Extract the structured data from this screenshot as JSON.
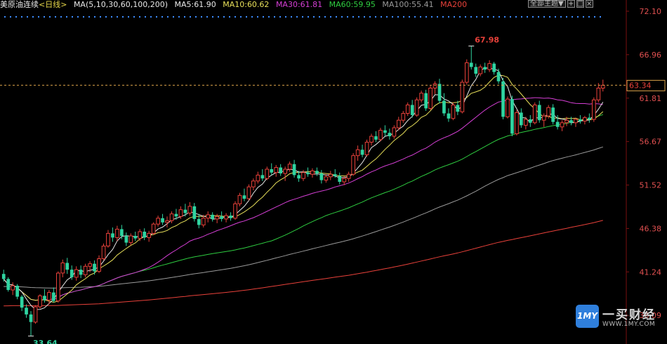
{
  "header": {
    "title": "美原油连续",
    "period": "<日线>",
    "ma_label": "MA(5,10,30,60,100,200)",
    "ma5": "MA5:61.90",
    "ma10": "MA10:60.62",
    "ma30": "MA30:61.81",
    "ma60": "MA60:59.95",
    "ma100": "MA100:55.41",
    "ma200": "MA200"
  },
  "toolbar": {
    "dropdown_label": "全部主题▼",
    "btn_add": "+",
    "btn_window": "□",
    "btn_close": "×"
  },
  "watermark": {
    "icon_text": "1MY",
    "title": "一买财经",
    "url": "WWW.1MY.COM"
  },
  "colors": {
    "up": "#e8413a",
    "down": "#2fd3a0",
    "ma5": "#e8e8e8",
    "ma10": "#e8e05a",
    "ma30": "#d63fd6",
    "ma60": "#2ecc40",
    "ma100": "#9a9a9a",
    "ma200": "#e8413a",
    "axis_text": "#e05050",
    "dotted": "#3c8cff",
    "hline": "#d9a24a"
  },
  "chart_data": {
    "type": "candlestick",
    "ylim": [
      33.2,
      72.1
    ],
    "y_ticks": [
      "72.10",
      "66.96",
      "61.81",
      "56.67",
      "51.52",
      "46.38",
      "41.24",
      "36.09"
    ],
    "current_price": "63.34",
    "annotations": {
      "high": "67.98",
      "low": "33.64"
    },
    "candles": [
      [
        41.0,
        41.5,
        40.1,
        40.4
      ],
      [
        40.4,
        40.6,
        38.9,
        39.1
      ],
      [
        39.1,
        40.0,
        38.5,
        39.6
      ],
      [
        39.6,
        39.8,
        38.0,
        38.3
      ],
      [
        38.3,
        38.5,
        36.6,
        37.0
      ],
      [
        37.0,
        37.4,
        35.8,
        36.2
      ],
      [
        36.2,
        36.6,
        33.64,
        35.3
      ],
      [
        35.3,
        37.3,
        35.1,
        37.1
      ],
      [
        37.1,
        38.6,
        36.9,
        38.4
      ],
      [
        38.4,
        39.2,
        37.6,
        37.9
      ],
      [
        37.9,
        39.1,
        37.4,
        38.8
      ],
      [
        38.8,
        39.4,
        37.6,
        37.8
      ],
      [
        37.8,
        41.3,
        37.6,
        41.1
      ],
      [
        41.1,
        42.7,
        40.6,
        42.3
      ],
      [
        42.3,
        42.9,
        41.0,
        41.5
      ],
      [
        41.5,
        42.0,
        40.3,
        40.6
      ],
      [
        40.6,
        41.9,
        40.2,
        41.5
      ],
      [
        41.5,
        42.0,
        40.5,
        40.9
      ],
      [
        40.9,
        42.2,
        40.6,
        41.9
      ],
      [
        41.9,
        42.5,
        41.2,
        42.2
      ],
      [
        42.2,
        42.6,
        40.9,
        41.3
      ],
      [
        41.3,
        43.2,
        41.1,
        42.8
      ],
      [
        42.8,
        44.6,
        42.6,
        44.3
      ],
      [
        44.3,
        46.2,
        44.1,
        45.8
      ],
      [
        45.8,
        46.5,
        44.8,
        45.3
      ],
      [
        45.3,
        46.7,
        44.9,
        46.3
      ],
      [
        46.3,
        46.8,
        45.1,
        45.5
      ],
      [
        45.5,
        45.9,
        44.3,
        44.7
      ],
      [
        44.7,
        45.8,
        44.4,
        45.5
      ],
      [
        45.5,
        46.0,
        44.9,
        45.2
      ],
      [
        45.2,
        46.3,
        44.9,
        46.0
      ],
      [
        46.0,
        46.4,
        45.0,
        45.3
      ],
      [
        45.3,
        46.1,
        44.8,
        45.8
      ],
      [
        45.8,
        47.1,
        45.6,
        46.9
      ],
      [
        46.9,
        47.9,
        46.6,
        47.6
      ],
      [
        47.6,
        48.1,
        46.8,
        47.1
      ],
      [
        47.1,
        47.8,
        46.5,
        47.3
      ],
      [
        47.3,
        48.4,
        47.0,
        48.1
      ],
      [
        48.1,
        48.7,
        47.4,
        47.8
      ],
      [
        47.8,
        49.0,
        47.5,
        48.6
      ],
      [
        48.6,
        49.3,
        47.8,
        48.2
      ],
      [
        48.2,
        49.5,
        47.9,
        49.0
      ],
      [
        49.0,
        49.4,
        47.2,
        47.5
      ],
      [
        47.5,
        48.1,
        46.4,
        46.8
      ],
      [
        46.8,
        48.0,
        46.5,
        47.6
      ],
      [
        47.6,
        48.4,
        47.1,
        48.0
      ],
      [
        48.0,
        48.3,
        47.2,
        47.5
      ],
      [
        47.5,
        48.1,
        47.0,
        47.8
      ],
      [
        47.8,
        48.4,
        47.2,
        47.5
      ],
      [
        47.5,
        48.2,
        47.1,
        47.9
      ],
      [
        47.9,
        48.3,
        47.3,
        47.6
      ],
      [
        47.6,
        49.6,
        47.4,
        49.3
      ],
      [
        49.3,
        50.6,
        49.0,
        50.3
      ],
      [
        50.3,
        51.1,
        49.6,
        49.9
      ],
      [
        49.9,
        51.6,
        49.7,
        51.3
      ],
      [
        51.3,
        52.3,
        50.9,
        52.0
      ],
      [
        52.0,
        53.1,
        51.7,
        52.7
      ],
      [
        52.7,
        53.4,
        52.0,
        52.3
      ],
      [
        52.3,
        53.7,
        52.1,
        53.4
      ],
      [
        53.4,
        54.1,
        52.7,
        53.0
      ],
      [
        53.0,
        53.9,
        52.5,
        53.6
      ],
      [
        53.6,
        54.0,
        52.6,
        52.9
      ],
      [
        52.9,
        53.7,
        52.0,
        53.4
      ],
      [
        53.4,
        54.3,
        53.1,
        54.0
      ],
      [
        54.0,
        54.5,
        52.4,
        52.7
      ],
      [
        52.7,
        53.2,
        51.9,
        52.3
      ],
      [
        52.3,
        53.3,
        52.0,
        53.0
      ],
      [
        53.0,
        53.6,
        52.5,
        52.8
      ],
      [
        52.8,
        53.5,
        52.4,
        53.2
      ],
      [
        53.2,
        53.6,
        52.6,
        52.9
      ],
      [
        52.9,
        53.3,
        51.7,
        52.1
      ],
      [
        52.1,
        52.8,
        51.8,
        52.5
      ],
      [
        52.5,
        53.2,
        52.1,
        52.8
      ],
      [
        52.8,
        53.4,
        52.4,
        52.6
      ],
      [
        52.6,
        53.0,
        51.6,
        51.9
      ],
      [
        51.9,
        52.6,
        51.5,
        52.3
      ],
      [
        52.3,
        53.1,
        51.9,
        52.8
      ],
      [
        52.8,
        55.3,
        52.6,
        55.0
      ],
      [
        55.0,
        56.2,
        54.4,
        55.7
      ],
      [
        55.7,
        56.3,
        54.8,
        55.1
      ],
      [
        55.1,
        56.9,
        54.9,
        56.6
      ],
      [
        56.6,
        57.6,
        56.2,
        57.3
      ],
      [
        57.3,
        57.9,
        56.6,
        56.9
      ],
      [
        56.9,
        58.3,
        56.7,
        58.0
      ],
      [
        58.0,
        58.6,
        57.3,
        57.7
      ],
      [
        57.7,
        58.2,
        56.9,
        57.3
      ],
      [
        57.3,
        58.6,
        57.0,
        58.3
      ],
      [
        58.3,
        59.6,
        58.0,
        59.2
      ],
      [
        59.2,
        60.3,
        58.9,
        60.0
      ],
      [
        60.0,
        61.3,
        59.7,
        61.0
      ],
      [
        61.0,
        61.6,
        59.5,
        59.8
      ],
      [
        59.8,
        61.9,
        59.6,
        61.6
      ],
      [
        61.6,
        62.7,
        61.3,
        62.4
      ],
      [
        62.4,
        62.8,
        60.3,
        60.6
      ],
      [
        60.6,
        63.3,
        60.4,
        63.0
      ],
      [
        63.0,
        63.8,
        62.3,
        63.5
      ],
      [
        63.5,
        64.1,
        61.2,
        61.5
      ],
      [
        61.5,
        62.4,
        59.7,
        60.0
      ],
      [
        60.0,
        60.6,
        59.0,
        59.4
      ],
      [
        59.4,
        61.3,
        59.2,
        61.0
      ],
      [
        61.0,
        61.5,
        59.8,
        60.2
      ],
      [
        60.2,
        64.0,
        60.0,
        63.7
      ],
      [
        63.7,
        66.4,
        63.4,
        66.0
      ],
      [
        66.0,
        67.98,
        65.2,
        65.5
      ],
      [
        65.5,
        65.9,
        64.3,
        64.7
      ],
      [
        64.7,
        65.8,
        64.4,
        65.5
      ],
      [
        65.5,
        66.0,
        64.8,
        65.2
      ],
      [
        65.2,
        66.3,
        64.9,
        65.9
      ],
      [
        65.9,
        66.1,
        64.6,
        64.9
      ],
      [
        64.9,
        65.3,
        63.5,
        63.8
      ],
      [
        63.8,
        64.2,
        59.3,
        59.6
      ],
      [
        59.6,
        62.0,
        59.4,
        61.7
      ],
      [
        61.7,
        62.1,
        57.3,
        57.6
      ],
      [
        57.6,
        60.4,
        57.4,
        60.1
      ],
      [
        60.1,
        60.6,
        58.3,
        58.6
      ],
      [
        58.6,
        59.6,
        58.1,
        59.3
      ],
      [
        59.3,
        59.8,
        58.4,
        58.9
      ],
      [
        58.9,
        61.3,
        58.7,
        61.0
      ],
      [
        61.0,
        61.5,
        58.9,
        59.2
      ],
      [
        59.2,
        60.0,
        58.4,
        59.7
      ],
      [
        59.7,
        61.0,
        59.4,
        60.7
      ],
      [
        60.7,
        61.1,
        58.7,
        59.0
      ],
      [
        59.0,
        59.8,
        58.1,
        58.4
      ],
      [
        58.4,
        59.2,
        57.9,
        58.9
      ],
      [
        58.9,
        59.6,
        58.5,
        59.2
      ],
      [
        59.2,
        59.6,
        58.6,
        58.9
      ],
      [
        58.9,
        59.5,
        58.4,
        59.3
      ],
      [
        59.3,
        59.8,
        58.8,
        59.1
      ],
      [
        59.1,
        59.7,
        58.7,
        59.5
      ],
      [
        59.5,
        60.0,
        58.9,
        59.3
      ],
      [
        59.3,
        61.9,
        59.0,
        61.6
      ],
      [
        61.6,
        63.6,
        61.3,
        63.0
      ],
      [
        63.0,
        64.0,
        62.6,
        63.34
      ]
    ]
  }
}
